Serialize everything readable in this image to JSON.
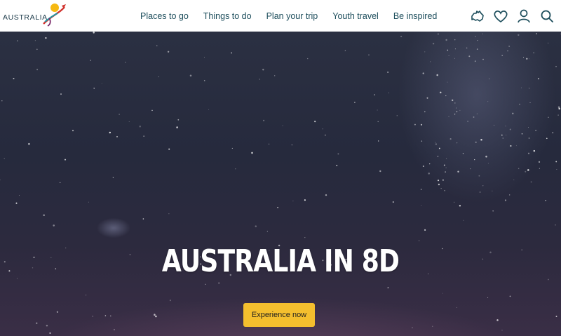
{
  "brand": {
    "wordmark": "AUSTRALIA",
    "logo_icon": "kangaroo-logo-icon"
  },
  "nav": {
    "items": [
      {
        "label": "Places to go"
      },
      {
        "label": "Things to do"
      },
      {
        "label": "Plan your trip"
      },
      {
        "label": "Youth travel"
      },
      {
        "label": "Be inspired"
      }
    ]
  },
  "header_icons": [
    "australia-map-icon",
    "heart-icon",
    "user-icon",
    "search-icon"
  ],
  "hero": {
    "title": "AUSTRALIA IN 8D",
    "cta_label": "Experience now"
  },
  "colors": {
    "nav_text": "#1d4e5c",
    "cta_bg": "#f4bf2e",
    "hero_bg": "#262a3d"
  }
}
